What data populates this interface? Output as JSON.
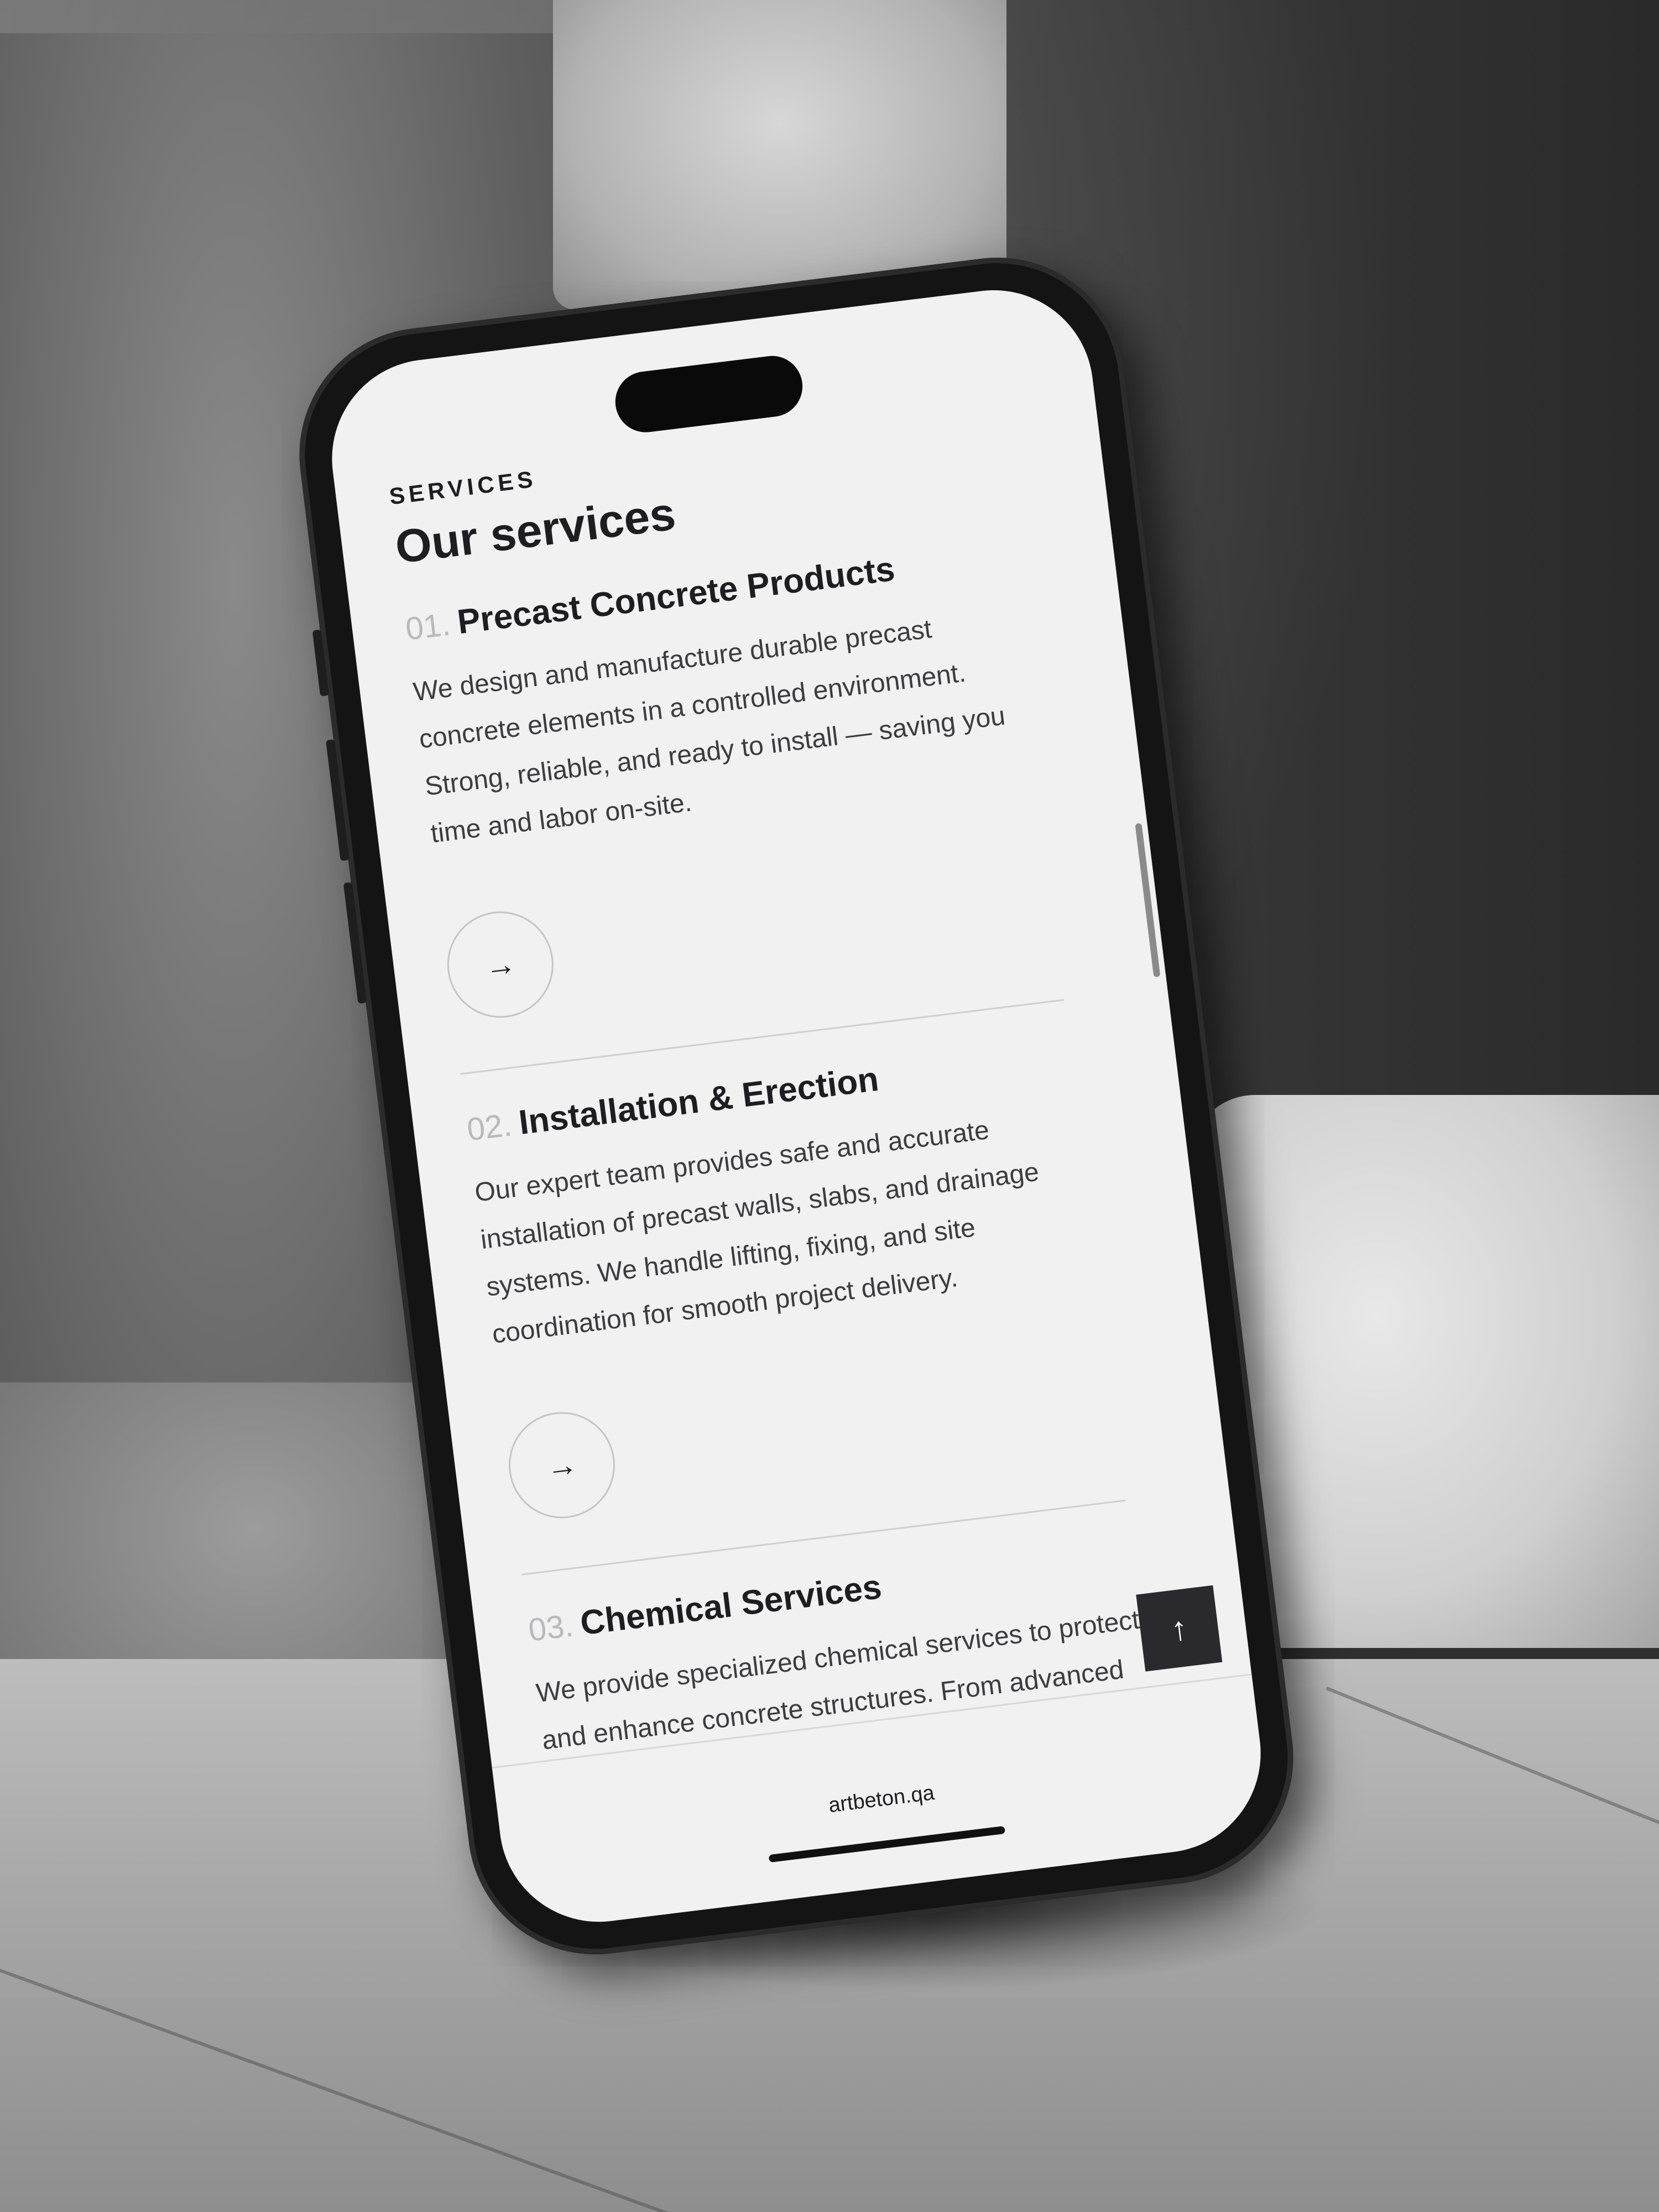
{
  "section": {
    "eyebrow": "SERVICES",
    "title": "Our services"
  },
  "services": [
    {
      "number": "01.",
      "title": "Precast Concrete Products",
      "description": "We design and manufacture durable precast concrete elements in a controlled environment. Strong, reliable, and ready to install — saving you time and labor on-site.",
      "arrow": "→"
    },
    {
      "number": "02.",
      "title": "Installation & Erection",
      "description": "Our expert team provides safe and accurate installation of precast walls, slabs, and drainage systems. We handle lifting, fixing, and site coordination for smooth project delivery.",
      "arrow": "→"
    },
    {
      "number": "03.",
      "title": "Chemical Services",
      "description": "We provide specialized chemical services to protect and enhance concrete structures. From advanced waterproofing to crack repair and long"
    }
  ],
  "back_to_top": "↑",
  "browser": {
    "url": "artbeton.qa"
  }
}
